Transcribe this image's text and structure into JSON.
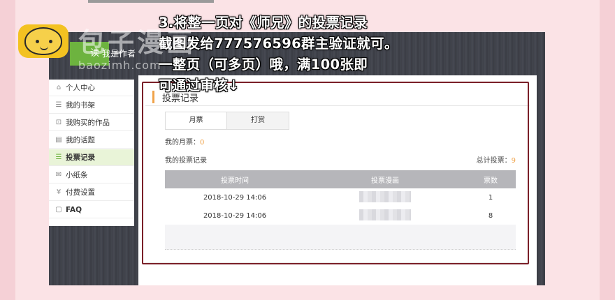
{
  "app": {
    "brand_label": "读 ",
    "author_link": "我是作者"
  },
  "sidebar": {
    "items": [
      {
        "icon": "home-icon",
        "glyph": "⌂",
        "label": "个人中心"
      },
      {
        "icon": "list-icon",
        "glyph": "☰",
        "label": "我的书架"
      },
      {
        "icon": "cart-icon",
        "glyph": "⊡",
        "label": "我购买的作品"
      },
      {
        "icon": "chat-icon",
        "glyph": "▤",
        "label": "我的话题"
      },
      {
        "icon": "vote-icon",
        "glyph": "☰",
        "label": "投票记录"
      },
      {
        "icon": "note-icon",
        "glyph": "✉",
        "label": "小纸条"
      },
      {
        "icon": "yen-icon",
        "glyph": "¥",
        "label": "付费设置"
      },
      {
        "icon": "faq-icon",
        "glyph": "▢",
        "label": "FAQ"
      }
    ]
  },
  "content": {
    "title": "投票记录",
    "tabs": [
      "月票",
      "打赏"
    ],
    "my_votes_label": "我的月票：",
    "my_votes_value": "0",
    "records_label": "我的投票记录",
    "total_label": "总计投票：",
    "total_value": "9",
    "table": {
      "headers": [
        "投票时间",
        "投票漫画",
        "票数"
      ],
      "rows": [
        {
          "time": "2018-10-29 14:06",
          "count": "1"
        },
        {
          "time": "2018-10-29 14:06",
          "count": "8"
        }
      ]
    }
  },
  "annotation": {
    "lines": [
      "3.将整一页对《师兄》的投票记录",
      "截图发给777576596群主验证就可。",
      "一整页（可多页）哦，满100张即",
      "可通过审核↓"
    ],
    "color": "#7a1f28"
  },
  "watermark": {
    "title": "包子漫画",
    "url": "baozimh.com"
  },
  "colors": {
    "accent_green": "#6db33f",
    "accent_orange": "#f0a34a",
    "background_pink": "#f5d0d6"
  }
}
